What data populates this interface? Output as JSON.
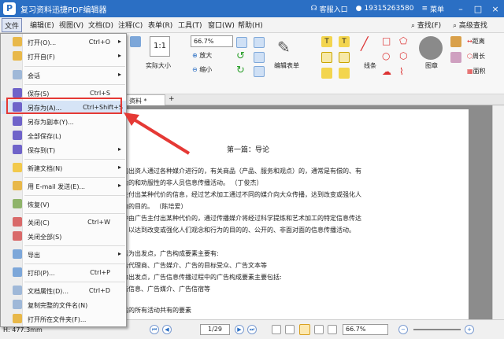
{
  "app": {
    "title": "复习资料迅捷PDF编辑器",
    "logo": "P"
  },
  "titlebar": {
    "service": "客服入口",
    "phone": "19315263580",
    "menu": "菜单"
  },
  "menubar": {
    "items": [
      "文件",
      "编辑(E)",
      "视图(V)",
      "文档(D)",
      "注释(C)",
      "表单(R)",
      "工具(T)",
      "窗口(W)",
      "帮助(H)"
    ],
    "find": "查找(F)",
    "adv_find": "高级查找"
  },
  "toolbar": {
    "zoom": "66.7%",
    "actual_size": "实际大小",
    "zoom_in": "放大",
    "zoom_out": "缩小",
    "edit_form": "编辑表单",
    "line": "线条",
    "stamp": "图章",
    "distance": "距离",
    "perimeter": "周长",
    "area": "面积"
  },
  "tab": {
    "name": "资料 *",
    "add": "+"
  },
  "document": {
    "heading": "第一篇：导论",
    "lines": [
      "的出资人通过各种媒介进行的，有关商品（产品、服务和观点）的，通常是有偿的、有",
      "合的和劝服性的非人员信息传播活动。                    （丁俊杰）",
      "主付出某种代价的信息，经过艺术加工通过不同的媒介向大众传播，达到改变或强化人",
      "为的目的。                                                      （陈培爱）",
      "种由广告主付出某种代价的，通过传播媒介将经过科学提炼和艺术加工的特定信息传达",
      "，以达到改变或强化人们观念和行为的目的的、公开的、非面对面的信息传播活动。",
      "",
      "者为出发点，广告构成要素主要有:",
      "告代理商、广告媒介、广告的目标受众、广告文本等",
      "为出发点，广告信息传播过程中的广告构成要素主要包括:",
      "告信息、广告媒介、广告信宿等",
      "",
      "后的所有活动共有的要素"
    ]
  },
  "status": {
    "coords": "H: 477.3mm",
    "page": "1/29",
    "zoom": "66.7%"
  },
  "file_menu": {
    "items": [
      {
        "label": "打开(O)...",
        "shortcut": "Ctrl+O",
        "arrow": "▸"
      },
      {
        "label": "打开自(F)",
        "shortcut": "",
        "arrow": "▸"
      },
      {
        "label": "会话",
        "shortcut": "",
        "arrow": "▸"
      },
      {
        "label": "保存(S)",
        "shortcut": "Ctrl+S",
        "arrow": ""
      },
      {
        "label": "另存为(A)...",
        "shortcut": "Ctrl+Shift+S",
        "arrow": ""
      },
      {
        "label": "另存为副本(Y)...",
        "shortcut": "",
        "arrow": ""
      },
      {
        "label": "全部保存(L)",
        "shortcut": "",
        "arrow": ""
      },
      {
        "label": "保存到(T)",
        "shortcut": "",
        "arrow": "▸"
      },
      {
        "label": "新建文档(N)",
        "shortcut": "",
        "arrow": "▸"
      },
      {
        "label": "用 E-mail 发送(E)...",
        "shortcut": "",
        "arrow": "▸"
      },
      {
        "label": "恢复(V)",
        "shortcut": "",
        "arrow": ""
      },
      {
        "label": "关闭(C)",
        "shortcut": "Ctrl+W",
        "arrow": ""
      },
      {
        "label": "关闭全部(S)",
        "shortcut": "",
        "arrow": ""
      },
      {
        "label": "导出",
        "shortcut": "",
        "arrow": "▸"
      },
      {
        "label": "打印(P)...",
        "shortcut": "Ctrl+P",
        "arrow": ""
      },
      {
        "label": "文档属性(D)...",
        "shortcut": "Ctrl+D",
        "arrow": ""
      },
      {
        "label": "复制完整的文件名(N)",
        "shortcut": "",
        "arrow": ""
      },
      {
        "label": "打开所在文件夹(F)...",
        "shortcut": "",
        "arrow": ""
      }
    ]
  }
}
